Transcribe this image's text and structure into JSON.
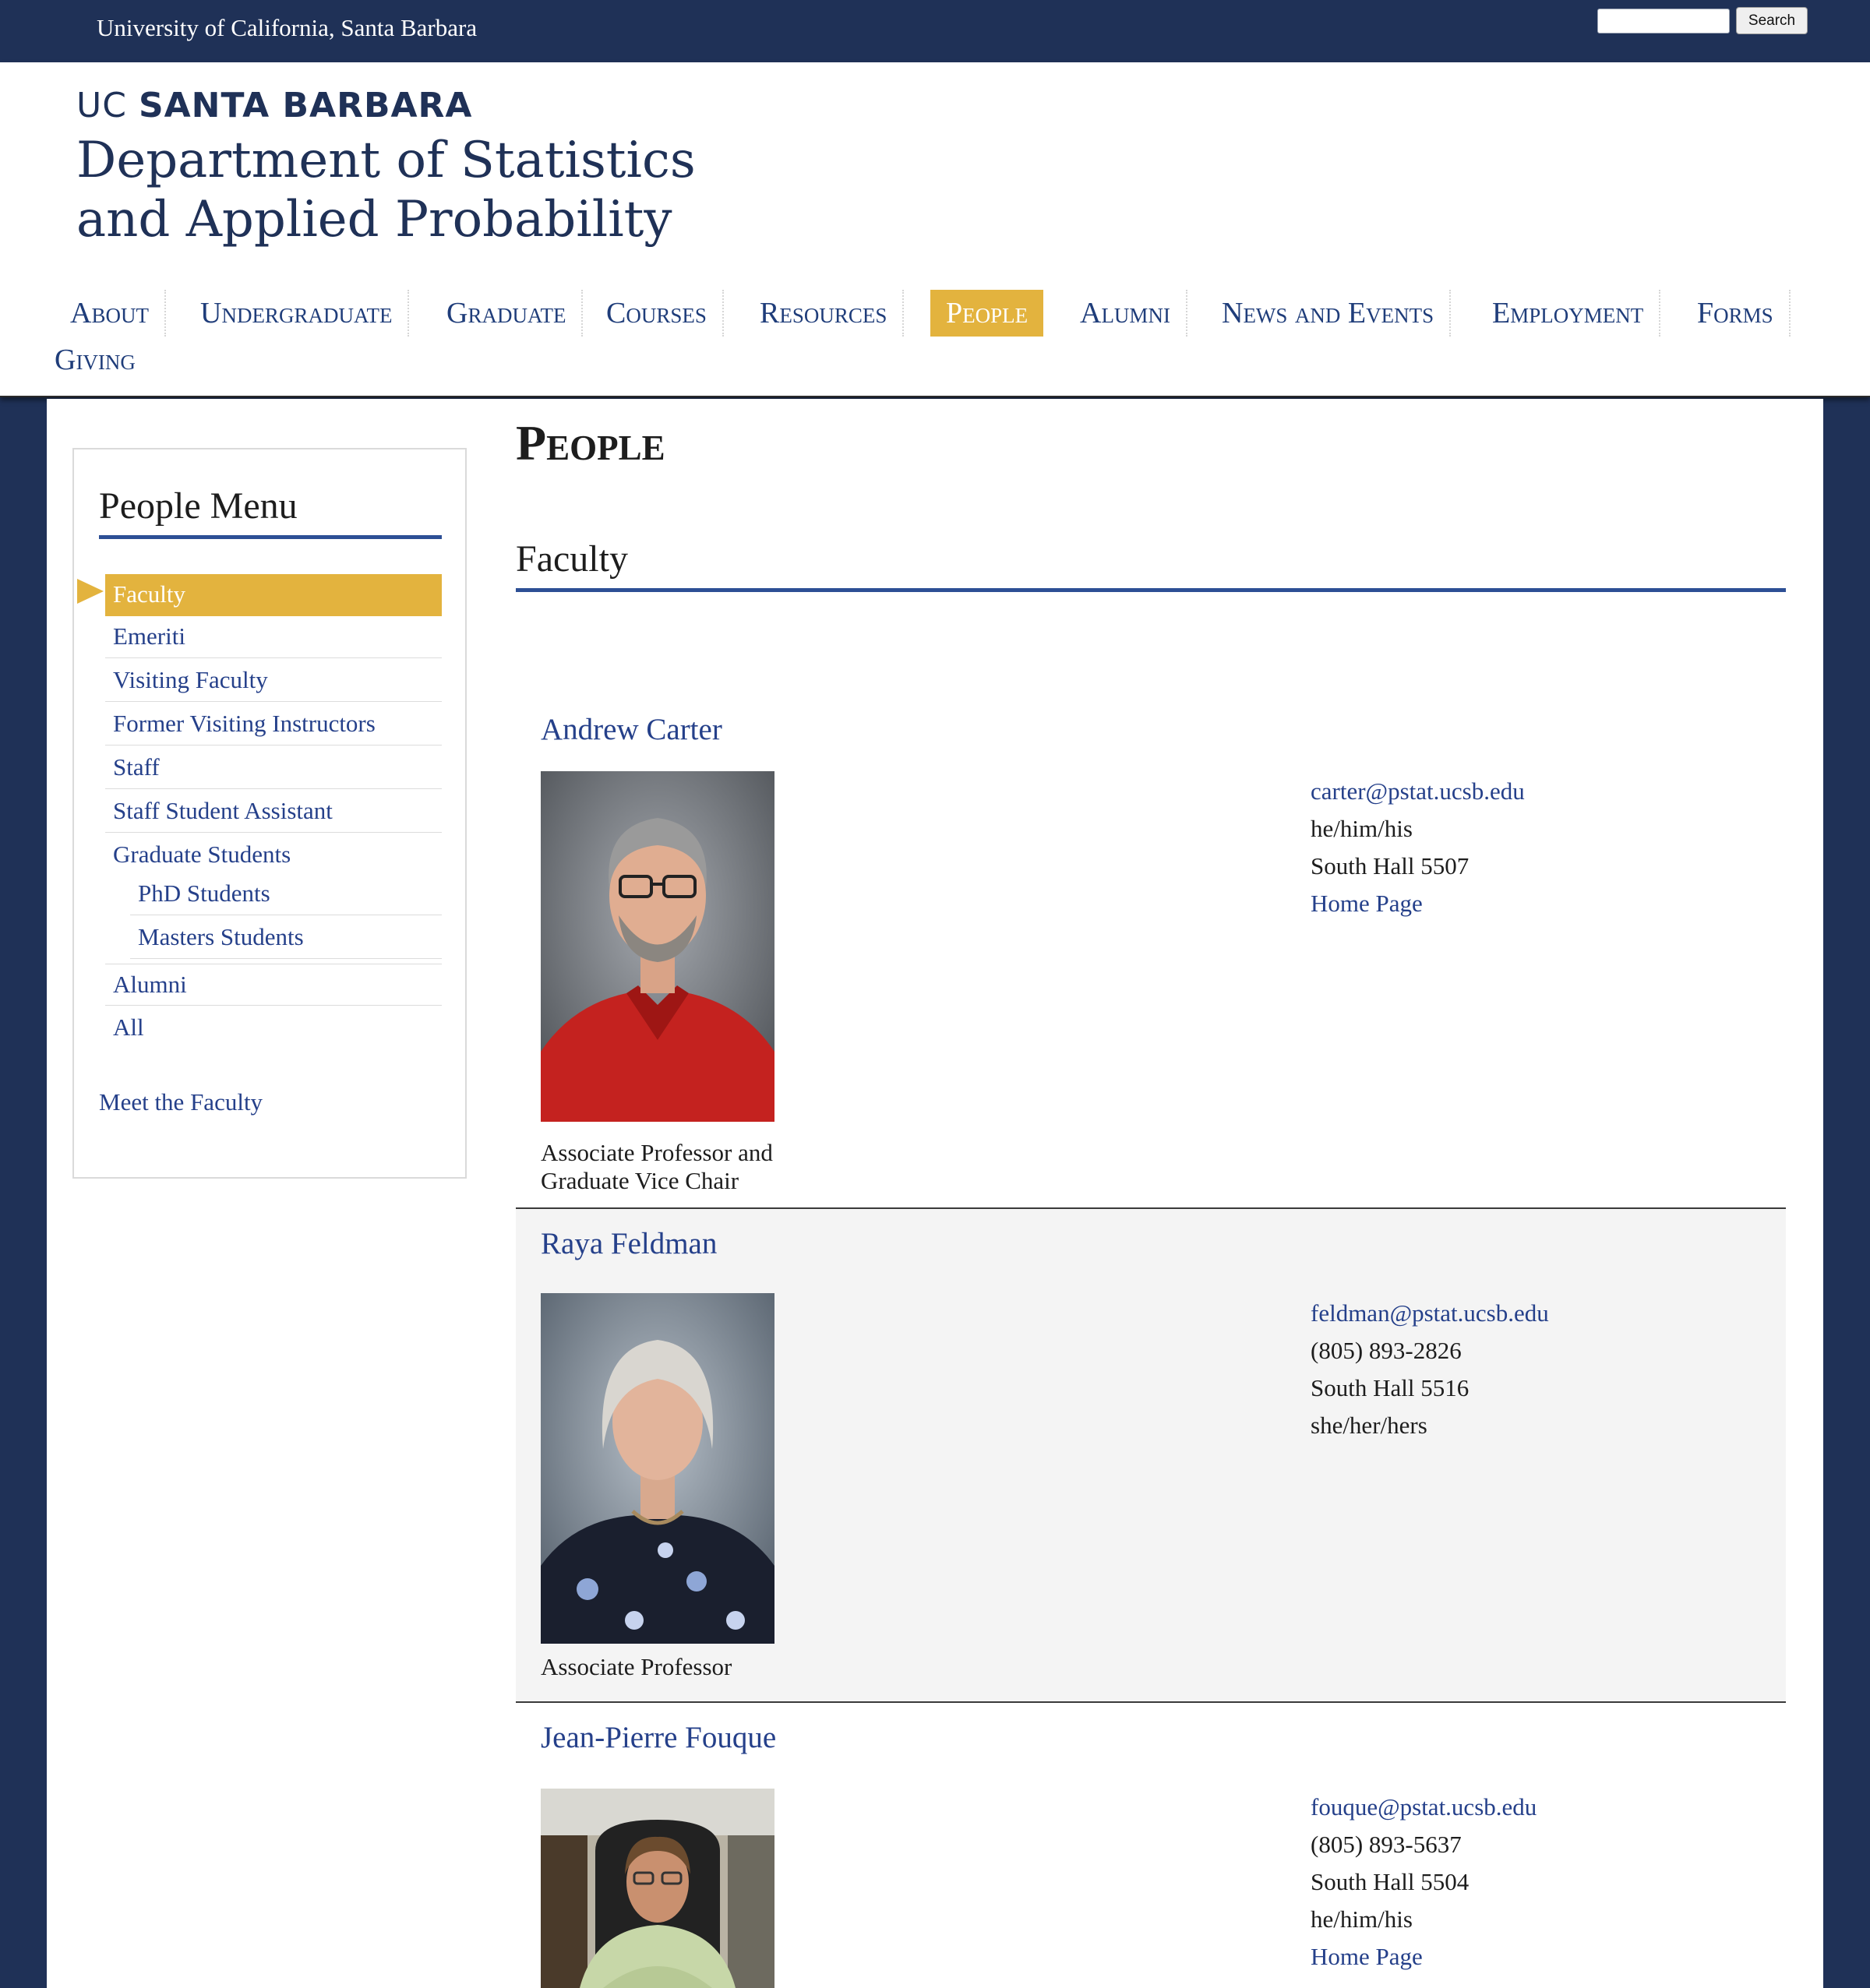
{
  "topbar": {
    "university": "University of California, Santa Barbara",
    "search_placeholder": "",
    "search_button": "Search"
  },
  "header": {
    "logo_uc": "UC",
    "logo_campus": "SANTA BARBARA",
    "dept_line1": "Department of Statistics",
    "dept_line2": "and Applied Probability"
  },
  "nav": {
    "items": [
      {
        "label": "About"
      },
      {
        "label": "Undergraduate"
      },
      {
        "label": "Graduate"
      },
      {
        "label": "Courses"
      },
      {
        "label": "Resources"
      },
      {
        "label": "People"
      },
      {
        "label": "Alumni"
      },
      {
        "label": "News and Events"
      },
      {
        "label": "Employment"
      },
      {
        "label": "Forms"
      },
      {
        "label": "Giving"
      }
    ],
    "active": "People"
  },
  "sidebar": {
    "title": "People Menu",
    "items": [
      {
        "label": "Faculty"
      },
      {
        "label": "Emeriti"
      },
      {
        "label": "Visiting Faculty"
      },
      {
        "label": "Former Visiting Instructors"
      },
      {
        "label": "Staff"
      },
      {
        "label": "Staff Student Assistant"
      },
      {
        "label": "Graduate Students"
      },
      {
        "label": "PhD Students"
      },
      {
        "label": "Masters Students"
      },
      {
        "label": "Alumni"
      },
      {
        "label": "All"
      }
    ],
    "active": "Faculty",
    "meet_link": "Meet the Faculty"
  },
  "content": {
    "page_title": "People",
    "section_title": "Faculty",
    "people": [
      {
        "name": "Andrew Carter",
        "title_line1": "Associate Professor and",
        "title_line2": "Graduate Vice Chair",
        "contact": [
          "carter@pstat.ucsb.edu",
          "he/him/his",
          "South Hall 5507",
          "Home Page"
        ]
      },
      {
        "name": "Raya Feldman",
        "title_line1": "Associate Professor",
        "title_line2": "",
        "contact": [
          "feldman@pstat.ucsb.edu",
          "(805) 893-2826",
          "South Hall 5516",
          "she/her/hers"
        ]
      },
      {
        "name": "Jean-Pierre Fouque",
        "title_line1": "",
        "title_line2": "",
        "contact": [
          "fouque@pstat.ucsb.edu",
          "(805) 893-5637",
          "South Hall 5504",
          "he/him/his",
          "Home Page"
        ]
      }
    ]
  },
  "colors": {
    "navy": "#1f3157",
    "link_blue": "#25408a",
    "gold": "#e3b33e",
    "rule_blue": "#2d4f95"
  }
}
